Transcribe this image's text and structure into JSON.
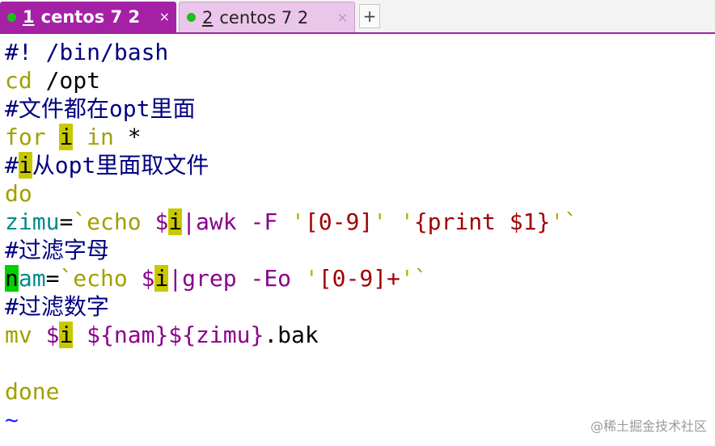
{
  "tabs": [
    {
      "num": "1",
      "label": "centos 7 2",
      "close": "×"
    },
    {
      "num": "2",
      "label": "centos 7 2",
      "close": "×"
    }
  ],
  "new_tab_label": "+",
  "editor": {
    "l1": "#! /bin/bash",
    "l2a": "cd",
    "l2b": " /opt",
    "l3a": "#",
    "l3b": "文件都在",
    "l3c": "opt",
    "l3d": "里面",
    "l4a": "for",
    "l4b": " ",
    "l4c": "i",
    "l4d": " ",
    "l4e": "in",
    "l4f": " *",
    "l5a": "#",
    "l5b": "i",
    "l5c": "从",
    "l5d": "opt",
    "l5e": "里面取文件",
    "l6": "do",
    "l7a": "zimu",
    "l7b": "=",
    "l7c": "`echo ",
    "l7d": "$",
    "l7e": "i",
    "l7f": "|awk -F ",
    "l7g": "'",
    "l7h": "[0-9]",
    "l7i": "'",
    "l7j": " ",
    "l7k": "'",
    "l7l": "{print $1}",
    "l7m": "'",
    "l7n": "`",
    "l8a": "#",
    "l8b": "过滤字母",
    "l9a": "n",
    "l9b": "am",
    "l9c": "=",
    "l9d": "`echo ",
    "l9e": "$",
    "l9f": "i",
    "l9g": "|grep -Eo ",
    "l9h": "'",
    "l9i": "[0-9]+",
    "l9j": "'",
    "l9k": "`",
    "l10a": "#",
    "l10b": "过滤数字",
    "l11a": "mv ",
    "l11b": "$",
    "l11c": "i",
    "l11d": " ",
    "l11e": "${nam}${zimu}",
    "l11f": ".bak",
    "l13": "done",
    "l14": "~"
  },
  "watermark": "@稀土掘金技术社区"
}
